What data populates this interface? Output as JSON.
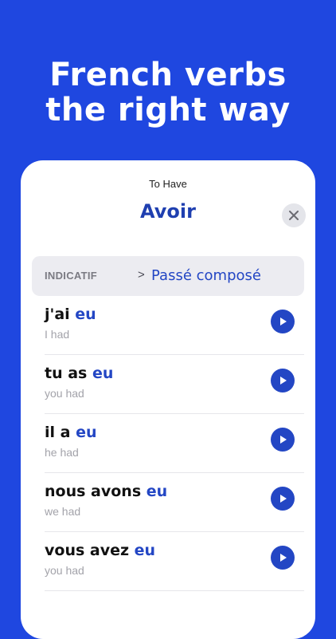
{
  "headline": {
    "line1": "French verbs",
    "line2": "the right way"
  },
  "card": {
    "subtitle": "To Have",
    "verb": "Avoir",
    "close_icon": "×"
  },
  "tense_bar": {
    "mood": "INDICATIF",
    "chevron": ">",
    "tense": "Passé composé"
  },
  "conjugations": [
    {
      "subject": "j'ai",
      "participle": "eu",
      "translation": "I had"
    },
    {
      "subject": "tu as",
      "participle": "eu",
      "translation": "you had"
    },
    {
      "subject": "il a",
      "participle": "eu",
      "translation": "he had"
    },
    {
      "subject": "nous avons",
      "participle": "eu",
      "translation": "we had"
    },
    {
      "subject": "vous avez",
      "participle": "eu",
      "translation": "you had"
    }
  ],
  "colors": {
    "background": "#1f47e0",
    "accent": "#2346c4",
    "title": "#1f3fb0"
  },
  "icons": {
    "close": "close-icon",
    "play": "play-icon",
    "chevron": "chevron-right-icon"
  }
}
